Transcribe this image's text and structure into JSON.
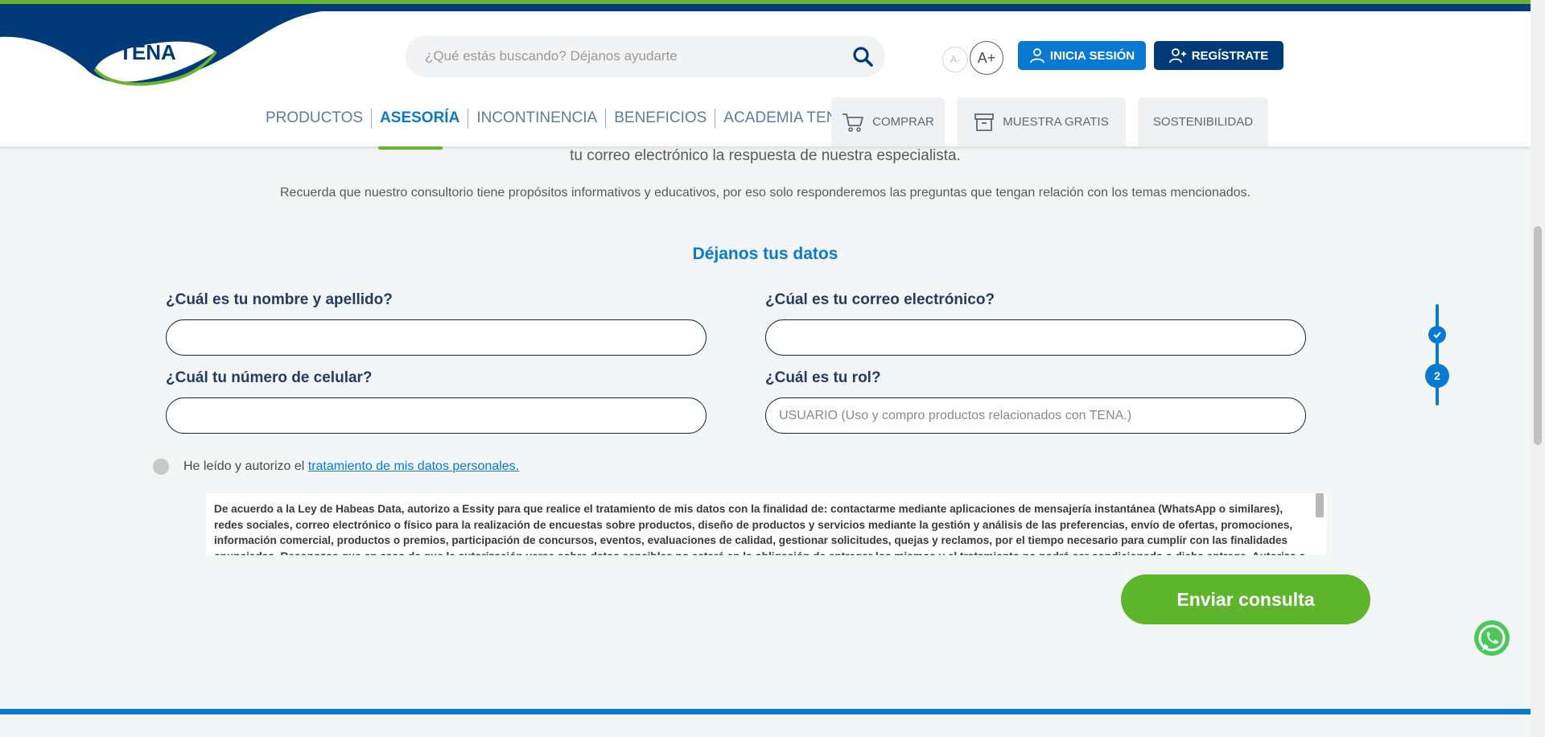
{
  "brand": {
    "logo_text": "TENA",
    "primary": "#003a79",
    "accent": "#0979d1",
    "green": "#6ab42d"
  },
  "header": {
    "search": {
      "placeholder": "¿Qué estás buscando? Déjanos ayudarte",
      "icon": "search-icon"
    },
    "font_decrease": "A-",
    "font_increase": "A+",
    "login_label": "INICIA SESIÓN",
    "register_label": "REGÍSTRATE"
  },
  "nav": {
    "items": [
      {
        "label": "PRODUCTOS",
        "active": false
      },
      {
        "label": "ASESORÍA",
        "active": true
      },
      {
        "label": "INCONTINENCIA",
        "active": false
      },
      {
        "label": "BENEFICIOS",
        "active": false
      },
      {
        "label": "ACADEMIA TENA",
        "active": false
      }
    ],
    "tabs": [
      {
        "label": "COMPRAR",
        "icon": "cart-icon"
      },
      {
        "label": "MUESTRA GRATIS",
        "icon": "box-icon"
      },
      {
        "label": "SOSTENIBILIDAD",
        "icon": ""
      }
    ]
  },
  "content": {
    "intro_text": "tu correo electrónico la respuesta de nuestra especialista.",
    "note_text": "Recuerda que nuestro consultorio tiene propósitos informativos y educativos, por eso solo responderemos las preguntas que tengan relación con los temas mencionados.",
    "section_title": "Déjanos tus datos"
  },
  "form": {
    "name_label": "¿Cuál es tu nombre y apellido?",
    "name_value": "",
    "email_label": "¿Cúal es tu correo electrónico?",
    "email_value": "",
    "phone_label": "¿Cuál tu número de celular?",
    "phone_value": "",
    "role_label": "¿Cuál es tu rol?",
    "role_placeholder": "USUARIO (Uso y compro productos relacionados con TENA.)",
    "consent_text": "He leído y autorizo el ",
    "consent_link": "tratamiento de mis datos personales.",
    "legal_text": "De acuerdo a la Ley de Habeas Data, autorizo a Essity para que realice el tratamiento de mis datos con la finalidad de: contactarme mediante aplicaciones de mensajería instantánea (WhatsApp o similares), redes sociales, correo electrónico o físico para la realización de encuestas sobre productos, diseño de productos y servicios mediante la gestión y análisis de las preferencias, envío de ofertas, promociones, información comercial, productos o premios, participación de concursos, eventos, evaluaciones de calidad, gestionar solicitudes, quejas y reclamos, por el tiempo necesario para cumplir con las finalidades enunciadas. Reconozco que en caso de que la autorización verse sobre datos sensibles no estaré en la obligación de entregar los mismos y el tratamiento no podrá ser condicionado a dicha entrega. Autorizo a que se realice la",
    "submit_label": "Enviar consulta"
  },
  "stepper": {
    "current_step": "2"
  }
}
